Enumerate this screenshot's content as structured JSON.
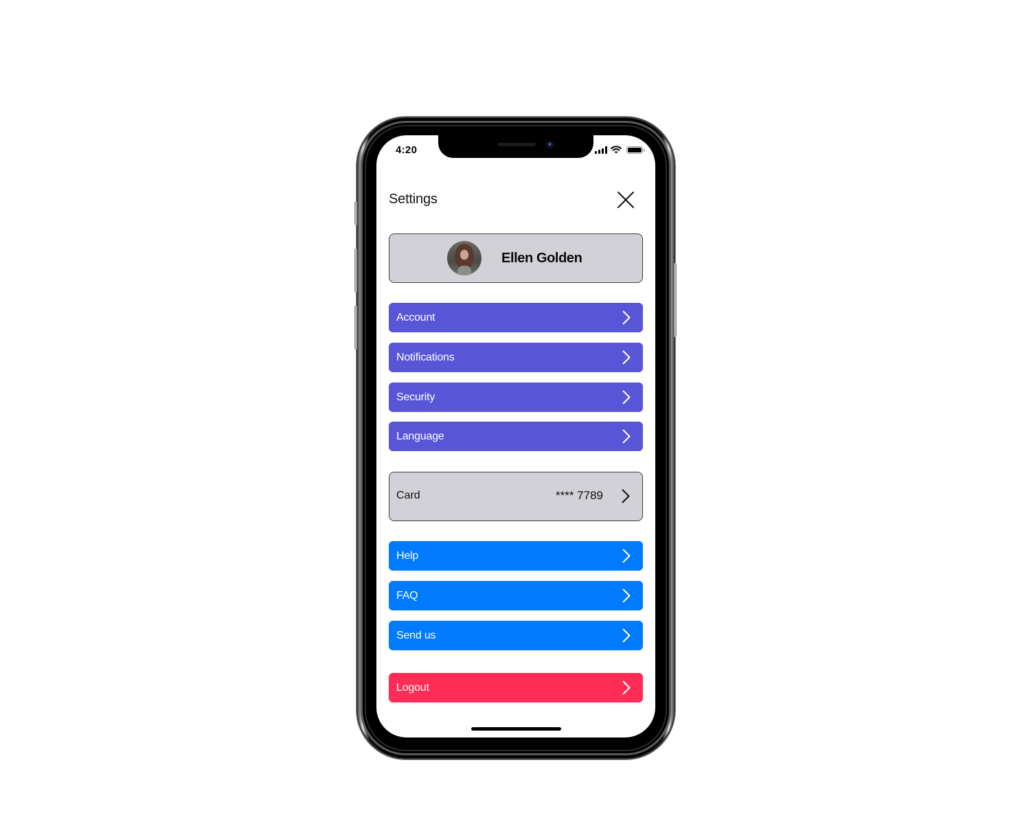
{
  "status_bar": {
    "time": "4:20",
    "icons": [
      "cellular-signal-icon",
      "wifi-icon",
      "battery-icon"
    ]
  },
  "header": {
    "title": "Settings",
    "close_icon": "close-icon"
  },
  "profile": {
    "name": "Ellen Golden",
    "avatar_icon": "avatar-photo"
  },
  "sections": {
    "preferences": [
      {
        "label": "Account",
        "icon": "chevron-right-icon"
      },
      {
        "label": "Notifications",
        "icon": "chevron-right-icon"
      },
      {
        "label": "Security",
        "icon": "chevron-right-icon"
      },
      {
        "label": "Language",
        "icon": "chevron-right-icon"
      }
    ],
    "payment": {
      "label": "Card",
      "value": "**** 7789",
      "icon": "chevron-right-icon"
    },
    "support": [
      {
        "label": "Help",
        "icon": "chevron-right-icon"
      },
      {
        "label": "FAQ",
        "icon": "chevron-right-icon"
      },
      {
        "label": "Send us",
        "icon": "chevron-right-icon"
      }
    ],
    "logout": {
      "label": "Logout",
      "icon": "chevron-right-icon"
    }
  },
  "colors": {
    "preferences_bg": "#5856d6",
    "support_bg": "#007aff",
    "logout_bg": "#ff2d55",
    "card_bg": "#d2d1d7",
    "text_on_color": "#ffffff"
  }
}
